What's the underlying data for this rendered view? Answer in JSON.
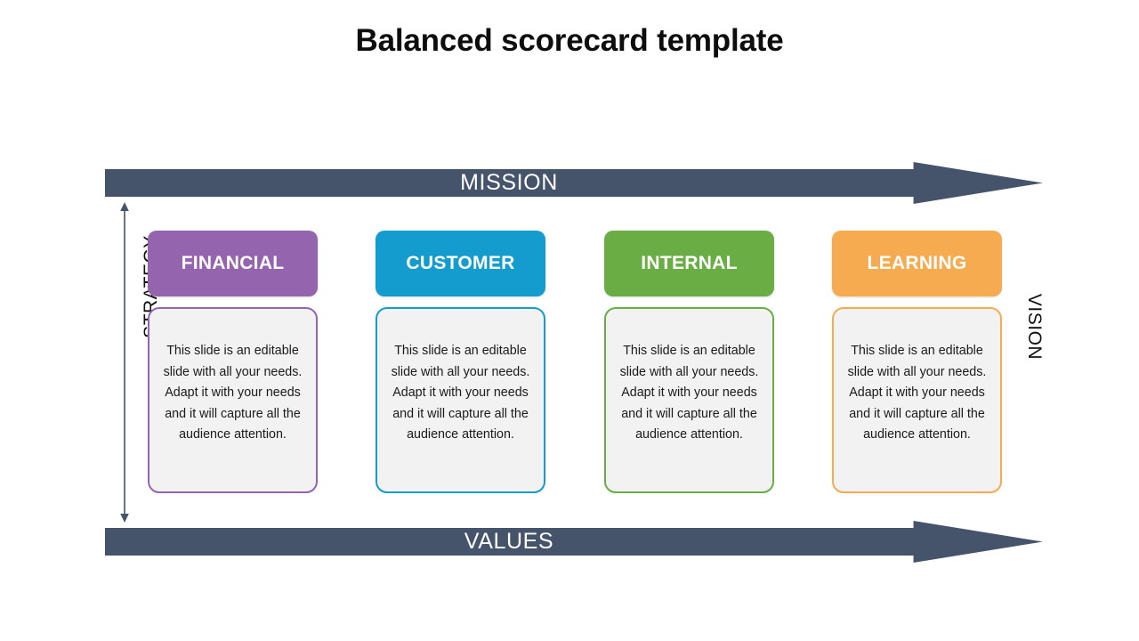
{
  "title": "Balanced scorecard template",
  "top_arrow": {
    "label": "MISSION"
  },
  "bottom_arrow": {
    "label": "VALUES"
  },
  "side_labels": {
    "left": "STRATEGY",
    "right": "VISION"
  },
  "colors": {
    "arrow_bar": "#45536B",
    "financial": "#9465AE",
    "customer": "#149CCE",
    "internal": "#6AAD45",
    "learning": "#F6AB51",
    "card_background": "#F2F2F2",
    "title_text": "#0D0D0D"
  },
  "body_text": "This slide is an editable slide with all your needs. Adapt it with your needs and it will capture all the audience attention.",
  "columns": [
    {
      "header": "FINANCIAL",
      "color": "#9465AE",
      "body": "This slide is an editable slide with all your needs. Adapt it with your needs and it will capture all the audience attention."
    },
    {
      "header": "CUSTOMER",
      "color": "#149CCE",
      "body": "This slide is an editable slide with all your needs. Adapt it with your needs and it will capture all the audience attention."
    },
    {
      "header": "INTERNAL",
      "color": "#6AAD45",
      "body": "This slide is an editable slide with all your needs. Adapt it with your needs and it will capture all the audience attention."
    },
    {
      "header": "LEARNING",
      "color": "#F6AB51",
      "body": "This slide is an editable slide with all your needs. Adapt it with your needs and it will capture all the audience attention."
    }
  ]
}
